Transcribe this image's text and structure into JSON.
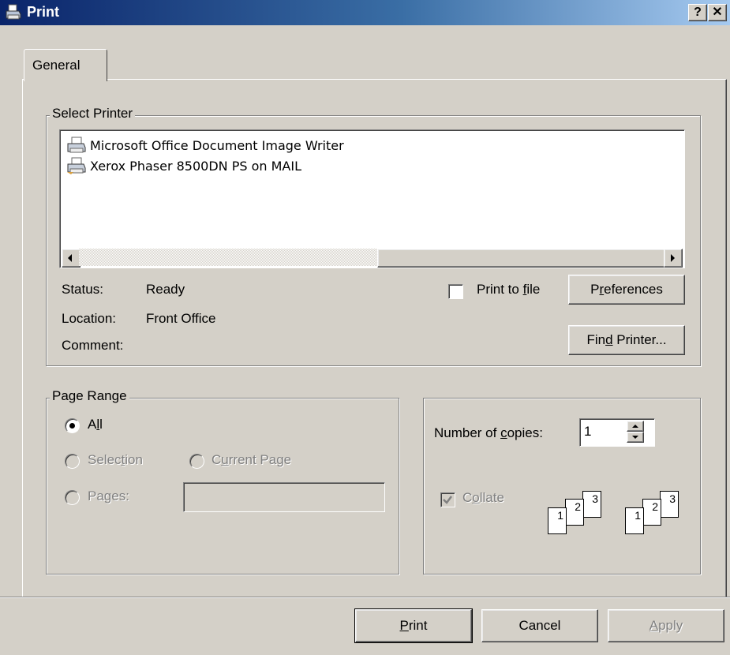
{
  "window": {
    "title": "Print",
    "help_label": "?",
    "close_label": "✕",
    "icon": "printer-icon"
  },
  "tabs": [
    {
      "label": "General",
      "selected": true
    }
  ],
  "select_printer": {
    "legend": "Select Printer",
    "printers": [
      {
        "name": "Microsoft Office Document Image Writer",
        "icon": "printer-icon"
      },
      {
        "name": "Xerox Phaser 8500DN PS on MAIL",
        "icon": "network-printer-icon"
      }
    ],
    "status_label": "Status:",
    "status_value": "Ready",
    "location_label": "Location:",
    "location_value": "Front Office",
    "comment_label": "Comment:",
    "comment_value": "",
    "print_to_file_pre": "Print to ",
    "print_to_file_key": "f",
    "print_to_file_post": "ile",
    "print_to_file_checked": false,
    "preferences_pre": "P",
    "preferences_key": "r",
    "preferences_post": "eferences",
    "find_printer_pre": "Fin",
    "find_printer_key": "d",
    "find_printer_post": " Printer..."
  },
  "page_range": {
    "legend": "Page Range",
    "all_pre": "A",
    "all_key": "l",
    "all_post": "l",
    "selection_pre": "Selec",
    "selection_key": "t",
    "selection_post": "ion",
    "current_pre": "C",
    "current_key": "u",
    "current_post": "rrent Page",
    "pages_pre": "Pa",
    "pages_key": "g",
    "pages_post": "es:",
    "pages_value": "",
    "selected": "All"
  },
  "copies": {
    "label_pre": "Number of ",
    "label_key": "c",
    "label_post": "opies:",
    "value": "1",
    "collate_pre": "C",
    "collate_key": "o",
    "collate_post": "llate",
    "collate_checked": true,
    "page_numbers": [
      "1",
      "2",
      "3"
    ]
  },
  "footer": {
    "print_key": "P",
    "print_post": "rint",
    "cancel_label": "Cancel",
    "apply_key": "A",
    "apply_post": "pply"
  },
  "colors": {
    "titlebar_start": "#0a246a",
    "titlebar_end": "#a6caf0",
    "face": "#d4d0c8",
    "disabled_text": "#808080"
  }
}
